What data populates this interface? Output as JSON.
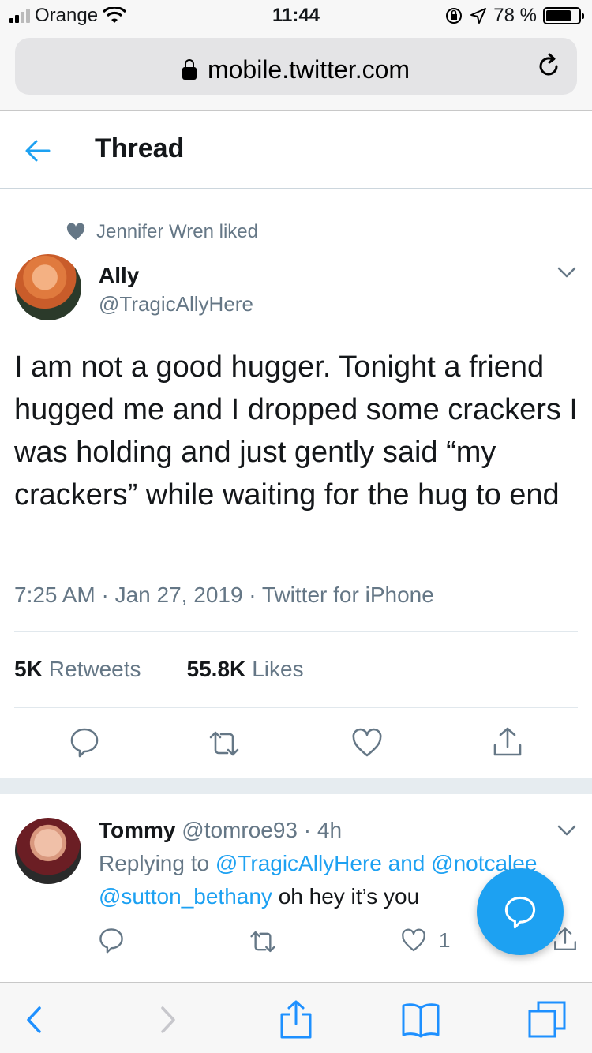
{
  "status_bar": {
    "carrier": "Orange",
    "time": "11:44",
    "battery": "78 %",
    "battery_level": 0.78
  },
  "browser": {
    "url": "mobile.twitter.com"
  },
  "header": {
    "title": "Thread"
  },
  "tweet": {
    "liked_by": "Jennifer Wren liked",
    "author_name": "Ally",
    "author_handle": "@TragicAllyHere",
    "text": "I am not a good hugger. Tonight a friend hugged me and I dropped some crackers I was holding and just gently said “my crackers” while waiting for the hug to end",
    "meta": "7:25 AM · Jan 27, 2019 · Twitter for iPhone",
    "retweets_count": "5K",
    "retweets_label": "Retweets",
    "likes_count": "55.8K",
    "likes_label": "Likes"
  },
  "reply": {
    "author_name": "Tommy",
    "author_handle": "@tomroe93",
    "time": "· 4h",
    "replying_prefix": "Replying to",
    "mention_1": "@TragicAllyHere",
    "and_word": "and",
    "mention_2": "@notcalee",
    "mention_3": "@sutton_bethany",
    "text": "oh hey it’s you",
    "like_count": "1"
  },
  "colors": {
    "accent": "#1da1f2",
    "secondary_text": "#657786",
    "primary_text": "#14171a"
  },
  "icons": [
    "back-arrow-icon",
    "lock-icon",
    "reload-icon",
    "heart-icon",
    "chevron-down-icon",
    "reply-icon",
    "retweet-icon",
    "share-icon",
    "compose-reply-icon",
    "safari-back-icon",
    "safari-forward-icon",
    "safari-share-icon",
    "bookmarks-icon",
    "tabs-icon"
  ]
}
